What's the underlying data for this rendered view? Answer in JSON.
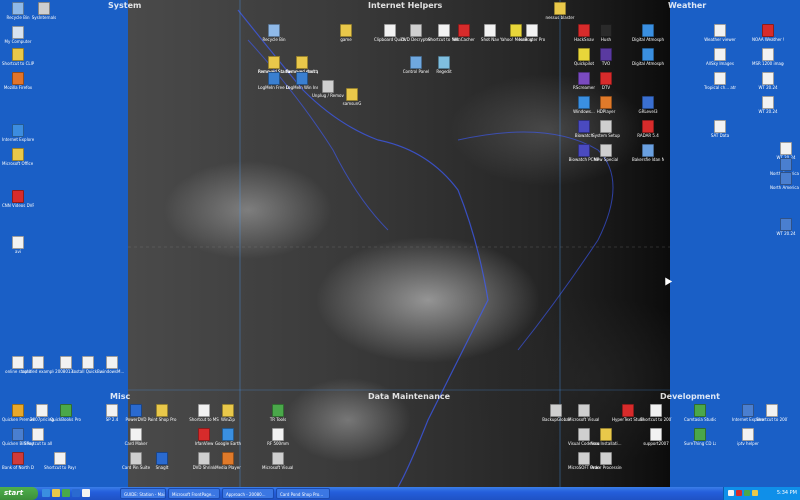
{
  "zones": {
    "system": "System",
    "internet": "Internet Helpers",
    "weather": "Weather",
    "misc": "Misc",
    "maintenance": "Data Maintenance",
    "development": "Development"
  },
  "icons": [
    {
      "name": "icon-recycle-bin",
      "label": "Recycle Bin",
      "color": "#8fb9e8"
    },
    {
      "name": "icon-sysinternals",
      "label": "SysInternals",
      "color": "#cfcfcf"
    },
    {
      "name": "icon-my-computer",
      "label": "My Computer",
      "color": "#d8e3f0"
    },
    {
      "name": "icon-shortcut-to-clipboard",
      "label": "Shortcut to CLIPMATE",
      "color": "#e9c84a"
    },
    {
      "name": "icon-mozilla-firefox",
      "label": "Mozilla Firefox",
      "color": "#e2742a"
    },
    {
      "name": "icon-internet-explorer",
      "label": "Internet Explorer",
      "color": "#3c8de0"
    },
    {
      "name": "icon-office-outlook",
      "label": "Microsoft Office Outl...",
      "color": "#e9c84a"
    },
    {
      "name": "icon-cnn-videos",
      "label": "CNN Videos DVR",
      "color": "#d72b2b"
    },
    {
      "name": "icon-avi",
      "label": "avi",
      "color": "#f2f2f2"
    },
    {
      "name": "icon-online-staple",
      "label": "online staple",
      "color": "#f2f2f2"
    },
    {
      "name": "icon-untitled-example",
      "label": "untitled example",
      "color": "#f2f2f2"
    },
    {
      "name": "icon-pdf-doc",
      "label": "2008013...",
      "color": "#f2f2f2"
    },
    {
      "name": "icon-install-quickbooks",
      "label": "Install QuickB...",
      "color": "#f2f2f2"
    },
    {
      "name": "icon-windows-mobile",
      "label": "windowsM...",
      "color": "#f2f2f2"
    },
    {
      "name": "icon-quicken-premier",
      "label": "Quicken Premier 2007",
      "color": "#e9a82a"
    },
    {
      "name": "icon-2007-pricing",
      "label": "2007pricing",
      "color": "#f2f2f2"
    },
    {
      "name": "icon-quickbooks-pro",
      "label": "QuickBooks Pro 2007",
      "color": "#4aa84a"
    },
    {
      "name": "icon-quicken-bill-pay",
      "label": "Quicken Bill Pay",
      "color": "#4a7fd0"
    },
    {
      "name": "icon-shortcut-to-payroll",
      "label": "Shortcut to Payroll",
      "color": "#f2f2f2"
    },
    {
      "name": "icon-bank-of-the-north",
      "label": "Bank of North Dakota",
      "color": "#cf3a3a"
    },
    {
      "name": "icon-shortcut-to-all",
      "label": "Shortcut to all",
      "color": "#f2f2f2"
    },
    {
      "name": "icon-recycle-bin-misc",
      "label": "Recycle Bin",
      "color": "#8fb9e8"
    },
    {
      "name": "icon-remove-startup-items",
      "label": "Removed Startup Items",
      "color": "#e9c84a"
    },
    {
      "name": "icon-removed-desktop-items",
      "label": "Removed desktop items",
      "color": "#e9c84a"
    },
    {
      "name": "icon-game",
      "label": "game",
      "color": "#e9c84a"
    },
    {
      "name": "icon-clipboard-quickcalc",
      "label": "Clipboard QuickCalc",
      "color": "#f2f2f2"
    },
    {
      "name": "icon-dvd-decrypter",
      "label": "DVD Decrypter",
      "color": "#cfcfcf"
    },
    {
      "name": "icon-shortcut-to-netmeeting",
      "label": "Shortcut to Net...",
      "color": "#f2f2f2"
    },
    {
      "name": "icon-wincacher",
      "label": "WinCacher",
      "color": "#d72b2b"
    },
    {
      "name": "icon-shot-nav",
      "label": "Shot Nav",
      "color": "#f2f2f2"
    },
    {
      "name": "icon-yahoo-messenger",
      "label": "Yahoo! Messenger",
      "color": "#e8d63a"
    },
    {
      "name": "icon-isobuster-pro",
      "label": "IsoBuster Pro",
      "color": "#f2f2f2"
    },
    {
      "name": "icon-nessus-blaster",
      "label": "nessus blaster",
      "color": "#e9c84a"
    },
    {
      "name": "icon-removed-startup-programs",
      "label": "Removed Startup Items",
      "color": "#e9c84a"
    },
    {
      "name": "icon-removed-start-programs",
      "label": "Removed start programs NT",
      "color": "#e9c84a"
    },
    {
      "name": "icon-control-panel",
      "label": "Control Panel",
      "color": "#6fa8e0"
    },
    {
      "name": "icon-regedit",
      "label": "Regedit",
      "color": "#7fbfe0"
    },
    {
      "name": "icon-logmein-free",
      "label": "LogMeIn Free Dvr...",
      "color": "#3a7fd0"
    },
    {
      "name": "icon-logmein-win",
      "label": "LogMeIn Win Install...",
      "color": "#3a7fd0"
    },
    {
      "name": "icon-unplug-hardware",
      "label": "Unplug / Remove",
      "color": "#cfcfcf"
    },
    {
      "name": "icon-samsung-gf",
      "label": "samsunG",
      "color": "#e9c84a"
    },
    {
      "name": "icon-hacksnav",
      "label": "HackSnav",
      "color": "#d72b2b"
    },
    {
      "name": "icon-hush",
      "label": "Hush",
      "color": "#2a2a2a"
    },
    {
      "name": "icon-quickpilot",
      "label": "Quickpilot",
      "color": "#e8d63a"
    },
    {
      "name": "icon-tvo",
      "label": "TVO",
      "color": "#5a3aa0"
    },
    {
      "name": "icon-digital-atmosphere",
      "label": "Digital Atmosphere",
      "color": "#3a8fe0"
    },
    {
      "name": "icon-rscreamer",
      "label": "RScreamer",
      "color": "#7a4ac0"
    },
    {
      "name": "icon-dtv",
      "label": "DTV",
      "color": "#d72b2b"
    },
    {
      "name": "icon-digital-atmosphere-2",
      "label": "Digital Atmosphere",
      "color": "#3a8fe0"
    },
    {
      "name": "icon-windows-media",
      "label": "Windows...",
      "color": "#3a8fe0"
    },
    {
      "name": "icon-hdplayer",
      "label": "HDPlayer",
      "color": "#e07a2a"
    },
    {
      "name": "icon-grlevel3",
      "label": "GRLevel3",
      "color": "#3a6fd0"
    },
    {
      "name": "icon-biowatch",
      "label": "Biowatch",
      "color": "#4a4ac0"
    },
    {
      "name": "icon-system-setup",
      "label": "System Setup",
      "color": "#cfcfcf"
    },
    {
      "name": "icon-radar-view",
      "label": "RADAR 5.4",
      "color": "#d72b2b"
    },
    {
      "name": "icon-biowatch-pomp",
      "label": "Biowatch PCMP",
      "color": "#4a4ac0"
    },
    {
      "name": "icon-new-special",
      "label": "New Special",
      "color": "#cfcfcf"
    },
    {
      "name": "icon-weather-bars",
      "label": "Bakersfie ldan NOFE GIS...",
      "color": "#6aa0e0"
    },
    {
      "name": "icon-weather-viewer",
      "label": "Weather viewer",
      "color": "#f2f2f2"
    },
    {
      "name": "icon-noaa-weather",
      "label": "NOAA Weather Worldview",
      "color": "#d72b2b"
    },
    {
      "name": "icon-allsky",
      "label": "AllSky Images",
      "color": "#f2f2f2"
    },
    {
      "name": "icon-msr-1200",
      "label": "MSR 1200 image...",
      "color": "#f2f2f2"
    },
    {
      "name": "icon-tropical-archive",
      "label": "Tropical ch... atmosphere",
      "color": "#f2f2f2"
    },
    {
      "name": "icon-wt-files",
      "label": "WT 20.24",
      "color": "#f2f2f2"
    },
    {
      "name": "icon-wt-files-2",
      "label": "WT 20.24",
      "color": "#f2f2f2"
    },
    {
      "name": "icon-sat-data",
      "label": "SAT Data",
      "color": "#f2f2f2"
    },
    {
      "name": "icon-wt-files-3",
      "label": "WT 20.24",
      "color": "#f2f2f2"
    },
    {
      "name": "icon-north-america",
      "label": "North America 20.24",
      "color": "#4a7fd0"
    },
    {
      "name": "icon-north-america-2",
      "label": "North America 20.24",
      "color": "#4a7fd0"
    },
    {
      "name": "icon-wt-files-4",
      "label": "WT 20.24",
      "color": "#4a7fd0"
    },
    {
      "name": "icon-sp-dat-1",
      "label": "SP 2.4",
      "color": "#f2f2f2"
    },
    {
      "name": "icon-power-dvd",
      "label": "PowerDVD",
      "color": "#2a6ad0"
    },
    {
      "name": "icon-paint-shop-pro",
      "label": "Paint Shop Pro",
      "color": "#e9c84a"
    },
    {
      "name": "icon-card-maker",
      "label": "Card Maker",
      "color": "#f2f2f2"
    },
    {
      "name": "icon-card-pin",
      "label": "Card Pin Suite",
      "color": "#cfcfcf"
    },
    {
      "name": "icon-snagit",
      "label": "SnagIt",
      "color": "#2a6ad0"
    },
    {
      "name": "icon-shortcut-to-ms",
      "label": "Shortcut to MS",
      "color": "#f2f2f2"
    },
    {
      "name": "icon-winzip",
      "label": "WinZip",
      "color": "#e9c84a"
    },
    {
      "name": "icon-irfanview",
      "label": "IrfanView",
      "color": "#d72b2b"
    },
    {
      "name": "icon-google-earth",
      "label": "Google Earth",
      "color": "#3a8fe0"
    },
    {
      "name": "icon-dvd-shrink",
      "label": "DVD Shrink",
      "color": "#cfcfcf"
    },
    {
      "name": "icon-media-player",
      "label": "Media Player",
      "color": "#e07a2a"
    },
    {
      "name": "icon-tr-tools",
      "label": "TR Tools",
      "color": "#4aa84a"
    },
    {
      "name": "icon-rf-500mm",
      "label": "RF 500mm",
      "color": "#f2f2f2"
    },
    {
      "name": "icon-ms-visual-basic",
      "label": "Microsoft Visual Basic 6.0",
      "color": "#cfcfcf"
    },
    {
      "name": "icon-backup-global",
      "label": "BackupGlobal",
      "color": "#cfcfcf"
    },
    {
      "name": "icon-ms-visual-studio",
      "label": "Microsoft Visual Studio",
      "color": "#cfcfcf"
    },
    {
      "name": "icon-visual-code",
      "label": "Visual Code scan",
      "color": "#cfcfcf"
    },
    {
      "name": "icon-new-install",
      "label": "New Installati...",
      "color": "#e9c84a"
    },
    {
      "name": "icon-microsoft-sql",
      "label": "MicroSOFT Processes",
      "color": "#cfcfcf"
    },
    {
      "name": "icon-order-processing",
      "label": "Order Processing",
      "color": "#cfcfcf"
    },
    {
      "name": "icon-hypertext-studio",
      "label": "HyperText Studio",
      "color": "#d72b2b"
    },
    {
      "name": "icon-shortcut-to-2007",
      "label": "Shortcut to 2007Install",
      "color": "#f2f2f2"
    },
    {
      "name": "icon-support-2007",
      "label": "support2007",
      "color": "#f2f2f2"
    },
    {
      "name": "icon-camtasia",
      "label": "Camtasia Studio 5",
      "color": "#4aa84a"
    },
    {
      "name": "icon-sure-thing",
      "label": "SureThing CD Labeler Del...",
      "color": "#4aa84a"
    },
    {
      "name": "icon-ie-helper",
      "label": "Internet Explorer 7",
      "color": "#4a7fd0"
    },
    {
      "name": "icon-shortcut-to-zoom",
      "label": "Shortcut to 2007Zoom",
      "color": "#f2f2f2"
    },
    {
      "name": "icon-iptv-helper",
      "label": "iptv helper",
      "color": "#f2f2f2"
    }
  ],
  "taskbar": {
    "start": "start",
    "tasks": [
      "GUIDE: Station - Mai...",
      "Microsoft FrontPage...",
      "Approach - 20080...",
      "Card Pond Shop Pro..."
    ],
    "clock": "5:34 PM"
  },
  "colors": {
    "desktop": "#1a5fc6",
    "taskbar": "#245edb",
    "start": "#3c8f3a"
  }
}
